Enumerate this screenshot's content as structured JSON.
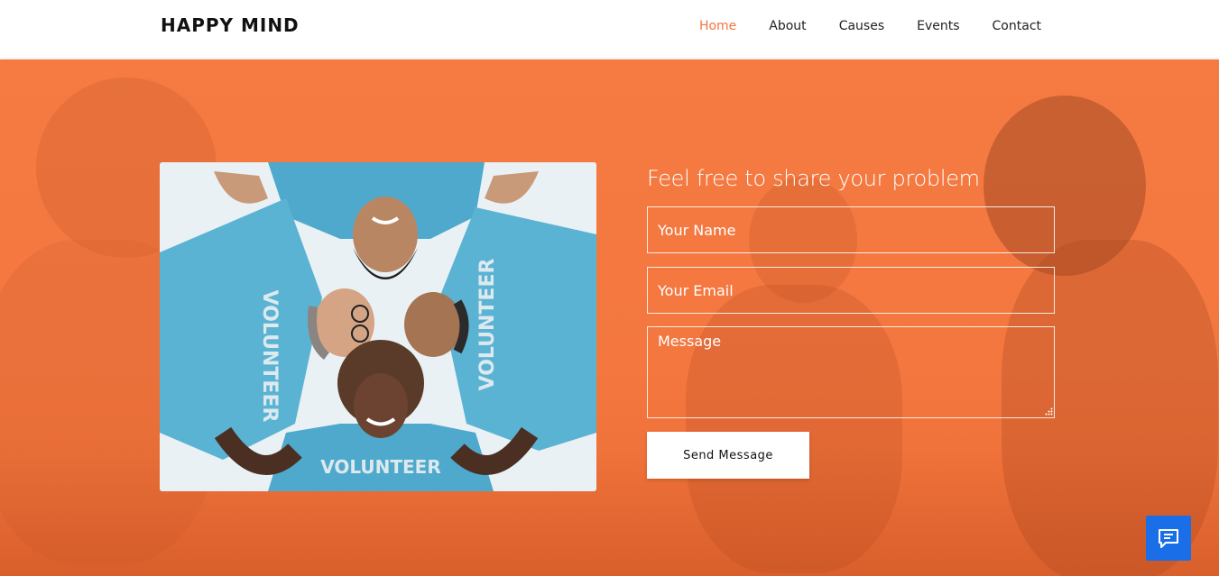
{
  "brand": {
    "name": "HAPPY MIND"
  },
  "nav": {
    "items": [
      {
        "label": "Home",
        "active": true
      },
      {
        "label": "About",
        "active": false
      },
      {
        "label": "Causes",
        "active": false
      },
      {
        "label": "Events",
        "active": false
      },
      {
        "label": "Contact",
        "active": false
      }
    ]
  },
  "hero": {
    "image_icon": "volunteers-group-photo",
    "form": {
      "title": "Feel free to share your problem",
      "name_placeholder": "Your Name",
      "email_placeholder": "Your Email",
      "message_placeholder": "Message",
      "submit_label": "Send Message"
    }
  },
  "chat": {
    "icon": "chat-bubble-icon"
  },
  "colors": {
    "accent": "#f6733d",
    "hero_overlay": "#f57b43",
    "chat_button": "#1a6fe8",
    "shirt": "#5ab3d3"
  }
}
